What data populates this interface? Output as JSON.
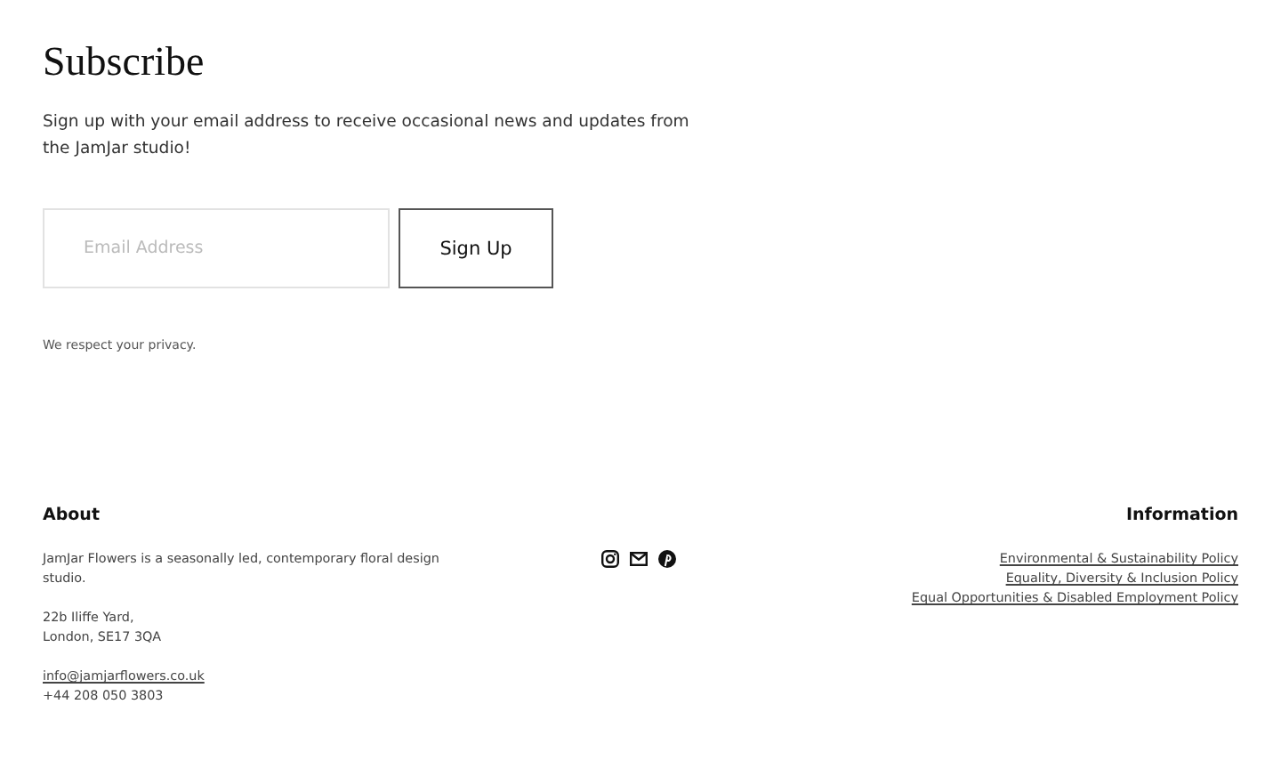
{
  "subscribe": {
    "title": "Subscribe",
    "description": "Sign up with your email address to receive occasional news and updates from the JamJar studio!",
    "email_field": {
      "placeholder": "Email Address"
    },
    "button": "Sign Up",
    "privacy_note": "We respect your privacy."
  },
  "footer": {
    "about": {
      "heading": "About",
      "description": "JamJar Flowers is a seasonally led, contemporary floral design studio.",
      "address_lines": [
        "22b Iliffe Yard,",
        "London, SE17 3QA"
      ],
      "email": "info@jamjarflowers.co.uk",
      "phone": "+44 208 050 3803"
    },
    "social": [
      {
        "kind": "instagram"
      },
      {
        "kind": "email"
      },
      {
        "kind": "pinterest"
      }
    ],
    "information": {
      "heading": "Information",
      "links": [
        "Environmental & Sustainability Policy",
        "Equality, Diversity & Inclusion Policy",
        "Equal Opportunities & Disabled Employment Policy"
      ]
    }
  }
}
